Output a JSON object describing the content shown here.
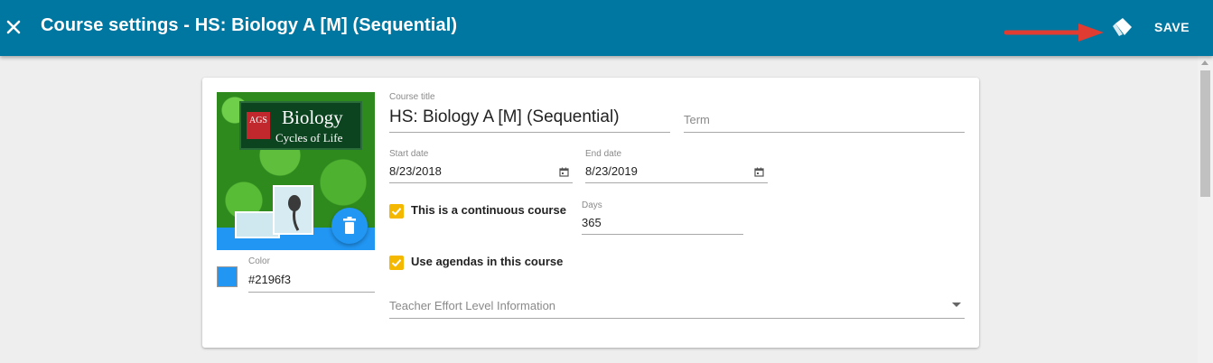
{
  "header": {
    "title": "Course settings - HS: Biology A [M] (Sequential)",
    "save_label": "SAVE",
    "close_icon": "close-icon",
    "tag_icon": "tag-icon",
    "bar_color": "#0077a0"
  },
  "cover": {
    "book_title": "Biology",
    "book_subtitle": "Cycles of Life",
    "publisher_logo": "AGS",
    "delete_icon": "trash-icon"
  },
  "color": {
    "label": "Color",
    "value": "#2196f3"
  },
  "form": {
    "course_title_label": "Course title",
    "course_title_value": "HS: Biology A [M] (Sequential)",
    "term_placeholder": "Term",
    "start_date_label": "Start date",
    "start_date_value": "8/23/2018",
    "end_date_label": "End date",
    "end_date_value": "8/23/2019",
    "continuous_label": "This is a continuous course",
    "continuous_checked": true,
    "days_label": "Days",
    "days_value": "365",
    "agendas_label": "Use agendas in this course",
    "agendas_checked": true,
    "effort_placeholder": "Teacher Effort Level Information",
    "checkbox_color": "#f5b800"
  }
}
